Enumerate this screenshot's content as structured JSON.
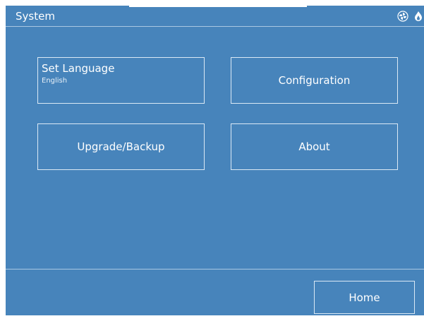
{
  "header": {
    "title": "System",
    "icons": [
      "fan-icon",
      "flame-icon"
    ]
  },
  "tiles": [
    {
      "label": "Set Language",
      "value": "English"
    },
    {
      "label": "Configuration"
    },
    {
      "label": "Upgrade/Backup"
    },
    {
      "label": "About"
    }
  ],
  "footer": {
    "home_label": "Home"
  },
  "colors": {
    "background": "#4784bb",
    "border": "#dbe9f5",
    "text": "#ffffff"
  }
}
